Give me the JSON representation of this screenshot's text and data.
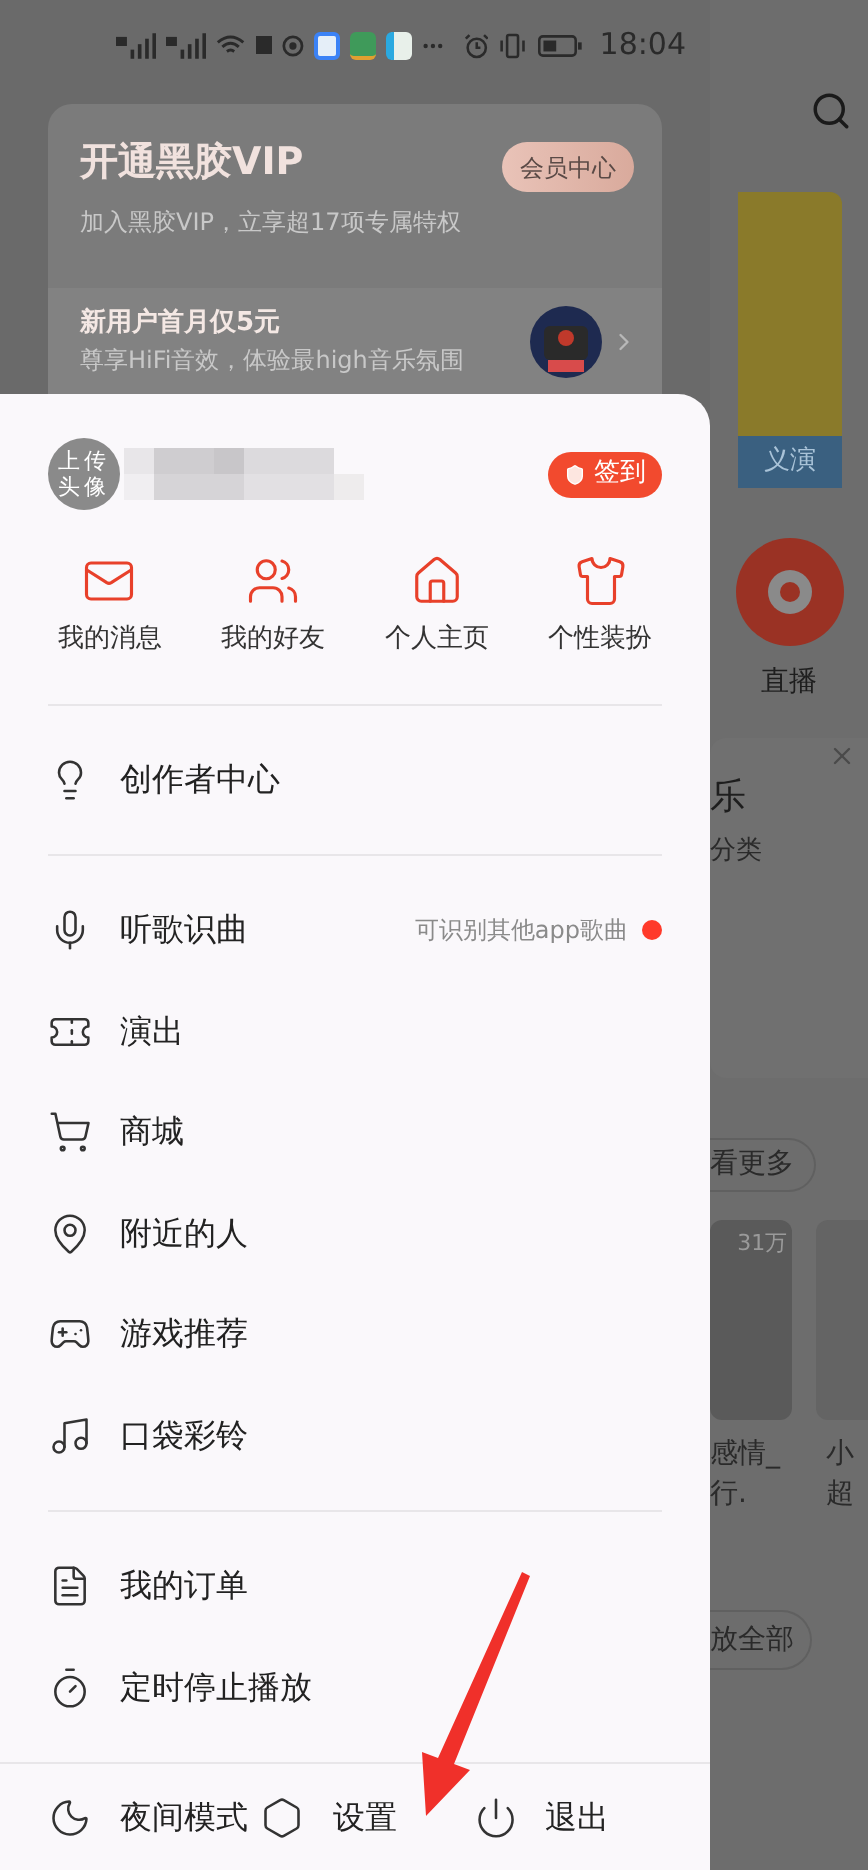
{
  "status_bar": {
    "time": "18:04"
  },
  "vip_card": {
    "title": "开通黑胶VIP",
    "subtitle": "加入黑胶VIP，立享超17项专属特权",
    "button": "会员中心",
    "promo_title": "新用户首月仅5元",
    "promo_subtitle": "尊享HiFi音效，体验最high音乐氛围"
  },
  "drawer": {
    "avatar_label": "上传头像",
    "checkin": "签到",
    "shortcuts": [
      {
        "kind": "mail",
        "label": "我的消息"
      },
      {
        "kind": "friends",
        "label": "我的好友"
      },
      {
        "kind": "home",
        "label": "个人主页"
      },
      {
        "kind": "shirt",
        "label": "个性装扮"
      }
    ],
    "sections": [
      [
        {
          "kind": "bulb",
          "label": "创作者中心",
          "unread": false
        }
      ],
      [
        {
          "kind": "mic",
          "label": "听歌识曲",
          "hint": "可识别其他app歌曲",
          "unread": true
        },
        {
          "kind": "ticket",
          "label": "演出",
          "unread": false
        },
        {
          "kind": "cart",
          "label": "商城",
          "unread": false
        },
        {
          "kind": "pin",
          "label": "附近的人",
          "unread": false
        },
        {
          "kind": "game",
          "label": "游戏推荐",
          "unread": false
        },
        {
          "kind": "ring",
          "label": "口袋彩铃",
          "unread": false
        }
      ],
      [
        {
          "kind": "order",
          "label": "我的订单",
          "unread": false
        },
        {
          "kind": "timer",
          "label": "定时停止播放",
          "unread": false
        }
      ]
    ],
    "footer": [
      {
        "kind": "moon",
        "label": "夜间模式"
      },
      {
        "kind": "settings",
        "label": "设置"
      },
      {
        "kind": "power",
        "label": "退出"
      }
    ]
  },
  "background": {
    "poster_tag": "义演",
    "live_label": "直播",
    "card_title": "乐",
    "card_subtitle": "分类",
    "more_button": "看更多",
    "play_count": "31万",
    "song_1_line_1": "感情_",
    "song_1_line_2": "行.",
    "song_2_line_1": "小",
    "song_2_line_2": "超",
    "play_all_button": "放全部"
  }
}
